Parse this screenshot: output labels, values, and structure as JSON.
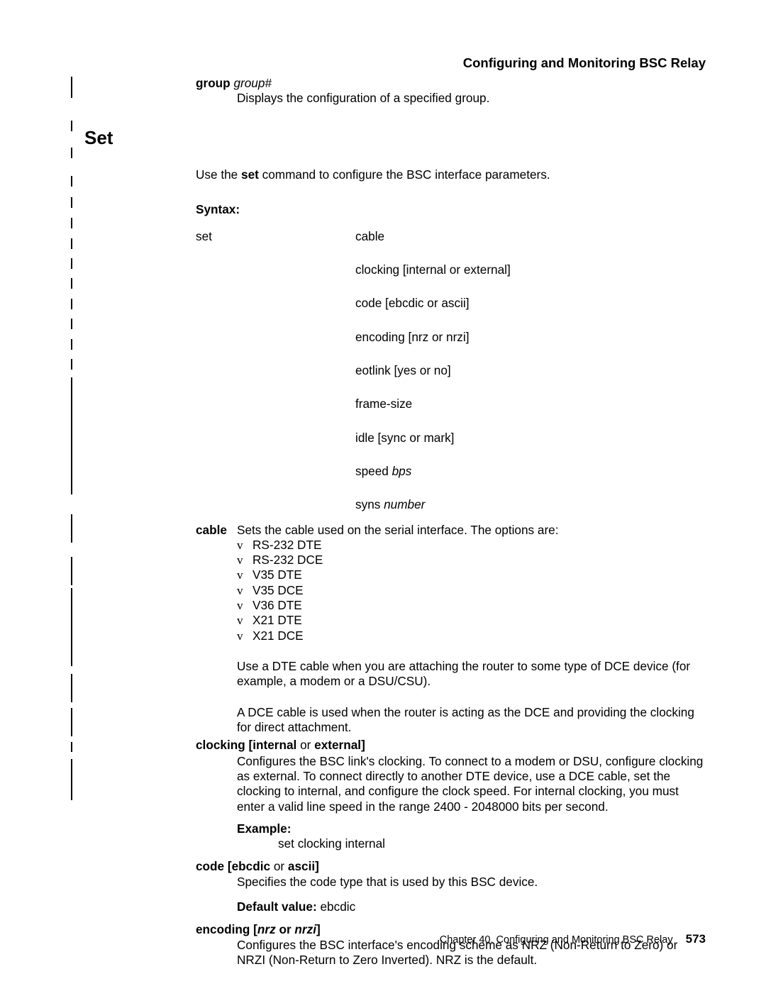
{
  "header": {
    "running_title": "Configuring and Monitoring BSC Relay"
  },
  "group": {
    "term_bold": "group",
    "term_italic": "group#",
    "desc": "Displays the configuration of a specified group."
  },
  "section": {
    "title": "Set",
    "intro_pre": "Use the ",
    "intro_cmd": "set",
    "intro_post": " command to configure the BSC interface parameters.",
    "syntax_label": "Syntax:",
    "cmd": "set",
    "options": {
      "cable": "cable",
      "clocking": "clocking [internal or external]",
      "code": "code [ebcdic or ascii]",
      "encoding": "encoding [nrz or nrzi]",
      "eotlink": "eotlink [yes or no]",
      "frame_size": "frame-size",
      "idle": "idle [sync or mark]",
      "speed_pre": "speed ",
      "speed_it": "bps",
      "syns_pre": "syns ",
      "syns_it": "number"
    }
  },
  "cable": {
    "term": "cable",
    "lead": "Sets the cable used on the serial interface. The options are:",
    "items": [
      "RS-232 DTE",
      "RS-232 DCE",
      "V35 DTE",
      "V35 DCE",
      "V36 DTE",
      "X21 DTE",
      "X21 DCE"
    ],
    "p1": "Use a DTE cable when you are attaching the router to some type of DCE device (for example, a modem or a DSU/CSU).",
    "p2": "A DCE cable is used when the router is acting as the DCE and providing the clocking for direct attachment."
  },
  "clocking": {
    "term_pre": "clocking [internal",
    "term_mid": " or ",
    "term_post": "external]",
    "desc": "Configures the BSC link's clocking. To connect to a modem or DSU, configure clocking as external. To connect directly to another DTE device, use a DCE cable, set the clocking to internal, and configure the clock speed. For internal clocking, you must enter a valid line speed in the range 2400 - 2048000 bits per second.",
    "example_label": "Example:",
    "example_text": "set clocking internal"
  },
  "code": {
    "term_pre": "code [ebcdic",
    "term_mid": " or ",
    "term_post": "ascii]",
    "desc": "Specifies the code type that is used by this BSC device.",
    "default_label": "Default value:",
    "default_value": " ebcdic"
  },
  "encoding": {
    "term_pre": "encoding [",
    "term_it1": "nrz",
    "term_mid": " or ",
    "term_it2": "nrzi",
    "term_post": "]",
    "desc": "Configures the BSC interface's encoding scheme as NRZ (Non-Return to Zero) or NRZI (Non-Return to Zero Inverted). NRZ is the default."
  },
  "footer": {
    "chapter": "Chapter 40. Configuring and Monitoring BSC Relay",
    "page": "573"
  }
}
